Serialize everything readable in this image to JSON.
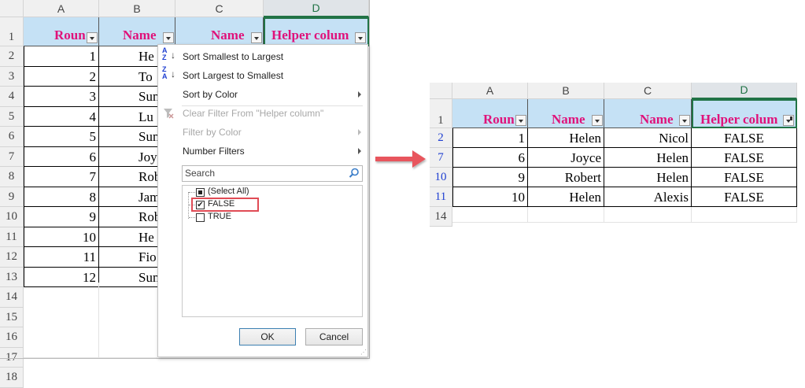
{
  "left_sheet": {
    "columns": [
      "A",
      "B",
      "C",
      "D"
    ],
    "row_numbers": [
      "1",
      "2",
      "3",
      "4",
      "5",
      "6",
      "7",
      "8",
      "9",
      "10",
      "11",
      "12",
      "13",
      "14",
      "15",
      "16",
      "17",
      "18"
    ],
    "headers": [
      "Roun",
      "Name",
      "Name",
      "Helper colum"
    ],
    "rows": [
      {
        "a": "1",
        "b": "He"
      },
      {
        "a": "2",
        "b": "To"
      },
      {
        "a": "3",
        "b": "Sun"
      },
      {
        "a": "4",
        "b": "Lu"
      },
      {
        "a": "5",
        "b": "Sun"
      },
      {
        "a": "6",
        "b": "Joy"
      },
      {
        "a": "7",
        "b": "Rob"
      },
      {
        "a": "8",
        "b": "Jam"
      },
      {
        "a": "9",
        "b": "Rob"
      },
      {
        "a": "10",
        "b": "He"
      },
      {
        "a": "11",
        "b": "Fio"
      },
      {
        "a": "12",
        "b": "Sun"
      }
    ]
  },
  "filter_menu": {
    "sort_asc": "Sort Smallest to Largest",
    "sort_desc": "Sort Largest to Smallest",
    "sort_color": "Sort by Color",
    "clear_filter": "Clear Filter From \"Helper column\"",
    "filter_color": "Filter by Color",
    "number_filters": "Number Filters",
    "search_placeholder": "Search",
    "options": [
      {
        "label": "(Select All)",
        "state": "partial"
      },
      {
        "label": "FALSE",
        "state": "checked"
      },
      {
        "label": "TRUE",
        "state": "unchecked"
      }
    ],
    "ok_label": "OK",
    "cancel_label": "Cancel",
    "sort_icon_az": "A\nZ",
    "sort_icon_za": "Z\nA"
  },
  "right_sheet": {
    "columns": [
      "A",
      "B",
      "C",
      "D"
    ],
    "row_numbers": [
      "1",
      "2",
      "7",
      "10",
      "11",
      "14"
    ],
    "headers": [
      "Roun",
      "Name",
      "Name",
      "Helper colum"
    ],
    "rows": [
      {
        "a": "1",
        "b": "Helen",
        "c": "Nicol",
        "d": "FALSE"
      },
      {
        "a": "6",
        "b": "Joyce",
        "c": "Helen",
        "d": "FALSE"
      },
      {
        "a": "9",
        "b": "Robert",
        "c": "Helen",
        "d": "FALSE"
      },
      {
        "a": "10",
        "b": "Helen",
        "c": "Alexis",
        "d": "FALSE"
      }
    ]
  },
  "colors": {
    "header_fill": "#c5e1f5",
    "header_text": "#e0127a",
    "arrow": "#e8545d",
    "row_hdr_filtered": "#1f3fd1"
  }
}
